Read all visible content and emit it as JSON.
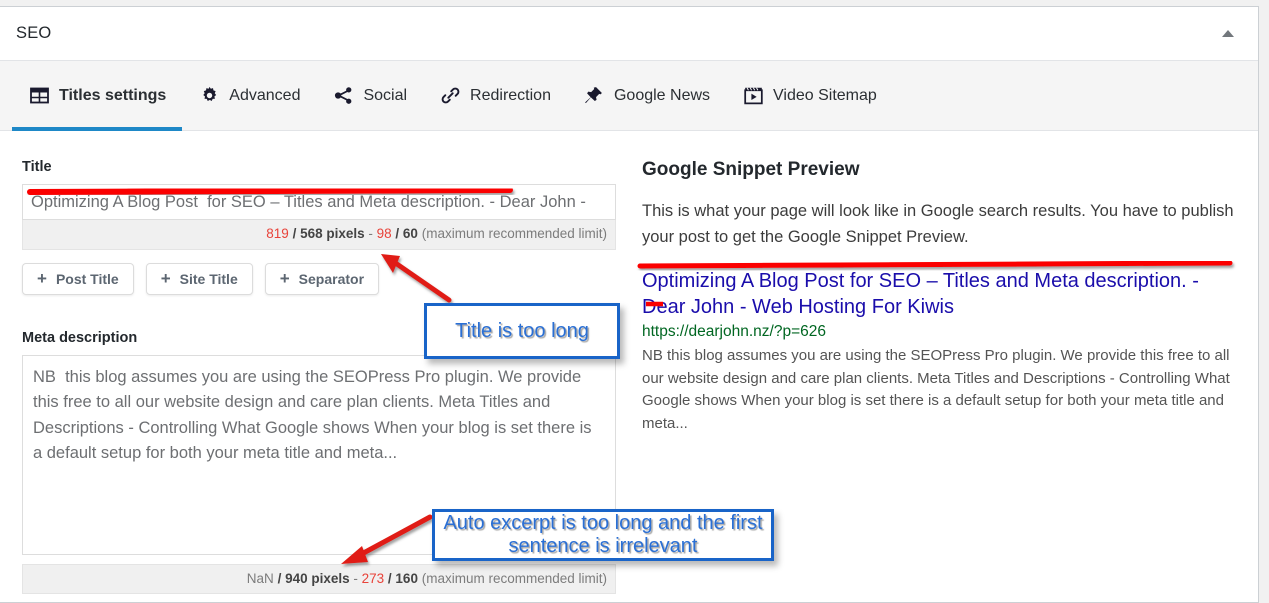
{
  "header": {
    "title": "SEO",
    "toggle_icon": "triangle-up-icon"
  },
  "tabs": [
    {
      "label": "Titles settings",
      "icon": "table-icon",
      "active": true
    },
    {
      "label": "Advanced",
      "icon": "gear-icon",
      "active": false
    },
    {
      "label": "Social",
      "icon": "share-icon",
      "active": false
    },
    {
      "label": "Redirection",
      "icon": "link-icon",
      "active": false
    },
    {
      "label": "Google News",
      "icon": "pin-icon",
      "active": false
    },
    {
      "label": "Video Sitemap",
      "icon": "video-clip-icon",
      "active": false
    }
  ],
  "title_field": {
    "label": "Title",
    "value": "Optimizing A Blog Post  for SEO – Titles and Meta description. - Dear John -",
    "counter": {
      "chars": "819",
      "sep1": " / ",
      "pixels": "568 pixels",
      "dash": " - ",
      "current": "98",
      "slash": " / ",
      "limit": "60",
      "note": " (maximum recommended limit)"
    }
  },
  "tag_buttons": [
    {
      "plus": "+",
      "label": "Post Title"
    },
    {
      "plus": "+",
      "label": "Site Title"
    },
    {
      "plus": "+",
      "label": "Separator"
    }
  ],
  "meta_field": {
    "label": "Meta description",
    "value": "NB  this blog assumes you are using the SEOPress Pro plugin. We provide this free to all our website design and care plan clients. Meta Titles and Descriptions - Controlling What Google shows When your blog is set there is a default setup for both your meta title and meta...",
    "counter": {
      "chars": "NaN",
      "sep1": " / ",
      "pixels": "940 pixels",
      "dash": " - ",
      "current": "273",
      "slash": " / ",
      "limit": "160",
      "note": " (maximum recommended limit)"
    }
  },
  "snippet": {
    "heading": "Google Snippet Preview",
    "intro": "This is what your page will look like in Google search results. You have to publish your post to get the Google Snippet Preview.",
    "title": "Optimizing A Blog Post for SEO – Titles and Meta description. - Dear John - Web Hosting For Kiwis",
    "url": "https://dearjohn.nz/?p=626",
    "description": "NB  this blog assumes you are using the SEOPress Pro plugin. We provide this free to all our website design and care plan clients. Meta Titles and Descriptions - Controlling What Google shows When your blog is set there is a default setup for both your meta title and meta..."
  },
  "annotations": {
    "callout_title": "Title is too long",
    "callout_excerpt": "Auto excerpt is too long and the first sentence is irrelevant"
  },
  "colors": {
    "accent": "#1e88c7",
    "annotation_border": "#1964c8",
    "annotation_text": "#2a6fd4",
    "marker_red": "#fb0000",
    "counter_red": "#e8433a",
    "snippet_link": "#1a0dab",
    "snippet_url": "#006621"
  }
}
